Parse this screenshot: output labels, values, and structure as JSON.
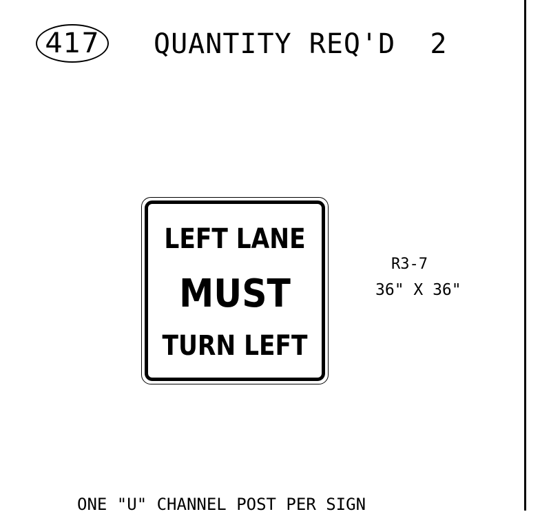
{
  "header": {
    "sign_number": "417",
    "quantity_text": "QUANTITY REQ'D  2"
  },
  "sign": {
    "line1": "LEFT LANE",
    "line2": "MUST",
    "line3": "TURN LEFT",
    "code": "R3-7",
    "size": "36\" X 36\"",
    "colors": {
      "background": "#ffffff",
      "legend": "#000000",
      "border": "#000000"
    }
  },
  "footer": {
    "post_note": "ONE \"U\" CHANNEL POST PER SIGN"
  }
}
